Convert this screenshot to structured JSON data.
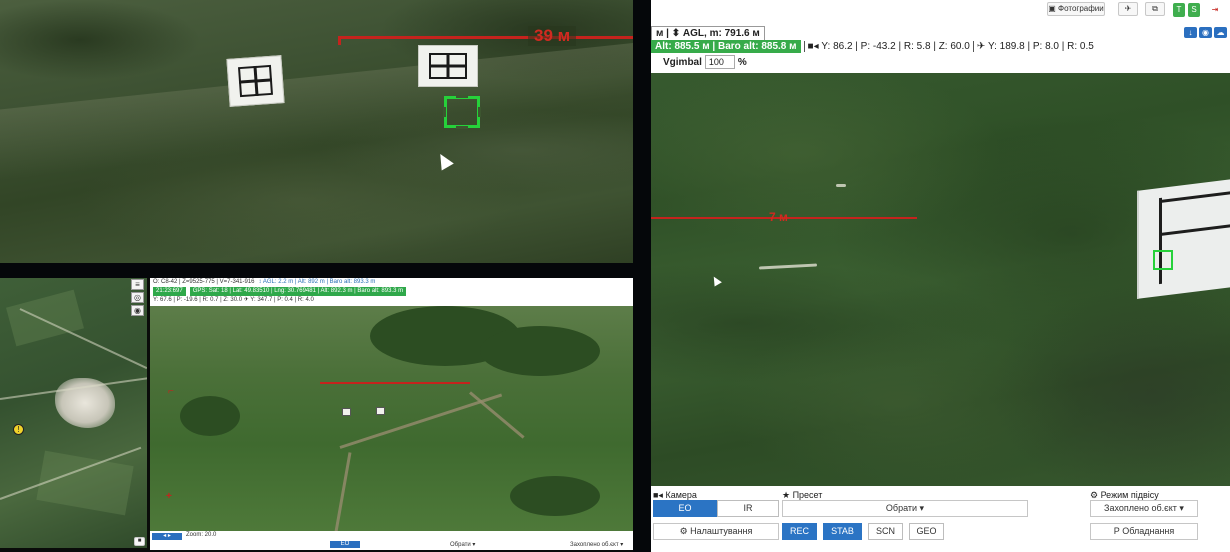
{
  "zoom_feed": {
    "range_label": "39 м"
  },
  "main_header": {
    "photos_label": "Фотографии",
    "tag_t": "T",
    "tag_s": "S",
    "agl_prefix": "м |",
    "agl": "⬍ AGL, m: 791.6 м",
    "alt": "Alt: 885.5 м | Baro alt: 885.8 м",
    "camera_attitude": "Y: 86.2 | P: -43.2 | R: 5.8 | Z: 60.0",
    "aircraft_attitude": "Y: 189.8 | P: 8.0 | R: 0.5",
    "gimbal_label": "Vgimbal",
    "gimbal_value": "100",
    "gimbal_unit": "%"
  },
  "main_feed": {
    "range_label": "7 м"
  },
  "controls": {
    "camera_title": "Камера",
    "camera_tabs": [
      "EO",
      "IR"
    ],
    "preset_title": "Пресет",
    "preset_select": "Обрати ▾",
    "gimbal_mode_title": "Режим підвісу",
    "gimbal_mode_select": "Захоплено об.єкт ▾",
    "settings_button": "Налаштування",
    "mode_buttons": [
      "REC",
      "STAB",
      "SCN",
      "GEO"
    ],
    "equipment_button": "Р Обладнання"
  },
  "mini_gcs": {
    "status_line_1": "O: C8-42 | Z=9525-775 | V=7-341-916",
    "status_line_1b": "↕ AGL: 2.2 m | Alt: 892 m | Baro alt: 893.3 m",
    "status_line_2_green": "21:23:697",
    "status_line_2_rest": "GPS: Sat: 18 | Lat: 49.83510 | Lng: 30.769481 | Alt: 892.3 m | Baro alt: 893.3 m",
    "attitude": "Y: 67.6 | P: -19.6 | R: 0.7 | Z: 30.0  ✈ Y: 347.7 | P: 0.4 | R: 4.0",
    "zoom_label": "Zoom: 20.0",
    "camera_tab": "EO",
    "preset_select": "Обрати ▾",
    "gimbal_select": "Захоплено об.єкт ▾"
  },
  "map": {
    "marker_label": "!"
  }
}
